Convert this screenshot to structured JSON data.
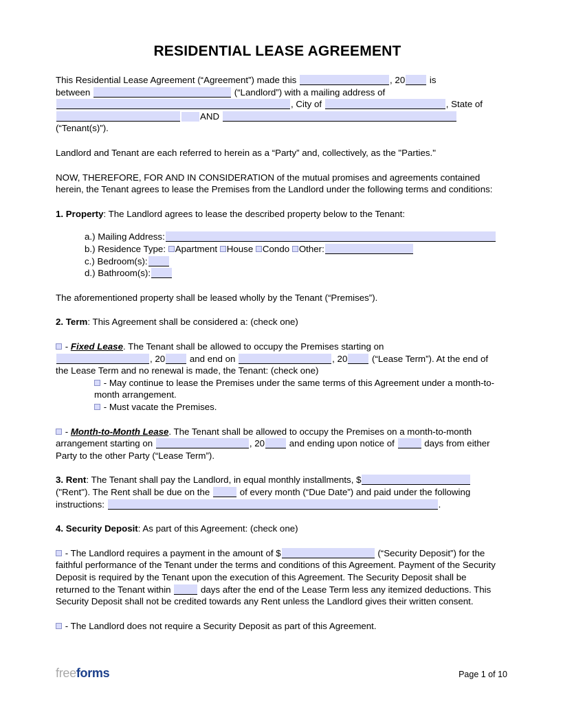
{
  "document": {
    "title": "RESIDENTIAL LEASE AGREEMENT",
    "colors": {
      "field_fill": "#d9dcfb",
      "field_rule": "#000000",
      "checkbox_border": "#8a90c8",
      "logo_gray": "#a8a8a8",
      "logo_blue": "#1b3f8b"
    }
  },
  "intro": {
    "l1_a": "This Residential Lease Agreement (“Agreement”) made this",
    "l1_b": ", 20",
    "l1_c": "is",
    "l2_a": "between",
    "l2_b": "(“Landlord”) with a mailing address of",
    "l3_a": ", City of",
    "l3_b": ", State of",
    "l4_a": "AND",
    "l4_b": "(“Tenant(s)”)."
  },
  "parties_clause": "Landlord and Tenant are each referred to herein as a “Party” and, collectively, as the \"Parties.\"",
  "consideration_clause": "NOW, THEREFORE, FOR AND IN CONSIDERATION of the mutual promises and agreements contained herein, the Tenant agrees to lease the Premises from the Landlord under the following terms and conditions:",
  "section1": {
    "number_label": "1. Property",
    "intro": ": The Landlord agrees to lease the described property below to the Tenant:",
    "items": {
      "a_label": "a.) Mailing Address:",
      "b_label": "b.) Residence Type:",
      "b_option1": "Apartment",
      "b_option2": "House",
      "b_option3": "Condo",
      "b_option4": "Other:",
      "c_label": "c.) Bedroom(s):",
      "d_label": "d.) Bathroom(s):"
    },
    "closing": "The aforementioned property shall be leased wholly by the Tenant (“Premises”)."
  },
  "section2": {
    "number_label": "2. Term",
    "intro": ": This Agreement shall be considered a: (check one)",
    "fixed": {
      "dash": "-",
      "name": "Fixed Lease",
      "t1": ". The Tenant shall be allowed to occupy the Premises starting on",
      "t2": ", 20",
      "t3": "and end on",
      "t4": ", 20",
      "t5": "(“Lease Term”). At the end of the Lease Term and no renewal is made, the Tenant: (check one)",
      "sub1": "- May continue to lease the Premises under the same terms of this Agreement under a month-to-month arrangement.",
      "sub2": "- Must vacate the Premises."
    },
    "mtm": {
      "dash": "-",
      "name": "Month-to-Month Lease",
      "t1": ". The Tenant shall be allowed to occupy the Premises on a month-to-month arrangement starting on",
      "t2": ", 20",
      "t3": "and ending upon notice of",
      "t4": "days from either Party to the other Party (“Lease Term”)."
    }
  },
  "section3": {
    "number_label": "3. Rent",
    "t1": ": The Tenant shall pay the Landlord, in equal monthly installments, $",
    "t2": "(\"Rent\"). The Rent shall be due on the",
    "t3": "of every month (“Due Date”) and paid under the following instructions:",
    "t4": "."
  },
  "section4": {
    "number_label": "4. Security Deposit",
    "intro": ": As part of this Agreement: (check one)",
    "option_required": {
      "dash": "-",
      "t1": "The Landlord requires a payment in the amount of $",
      "t2": "(“Security Deposit”) for the faithful performance of the Tenant under the terms and conditions of this Agreement. Payment of the Security Deposit is required by the Tenant upon the execution of this Agreement. The Security Deposit shall be returned to the Tenant within",
      "t3": "days after the end of the Lease Term less any itemized deductions. This Security Deposit shall not be credited towards any Rent unless the Landlord gives their written consent."
    },
    "option_not_required": {
      "dash": "-",
      "text": "The Landlord does not require a Security Deposit as part of this Agreement."
    }
  },
  "footer": {
    "logo_part1": "free",
    "logo_part2": "forms",
    "page_number": "Page 1 of 10"
  }
}
